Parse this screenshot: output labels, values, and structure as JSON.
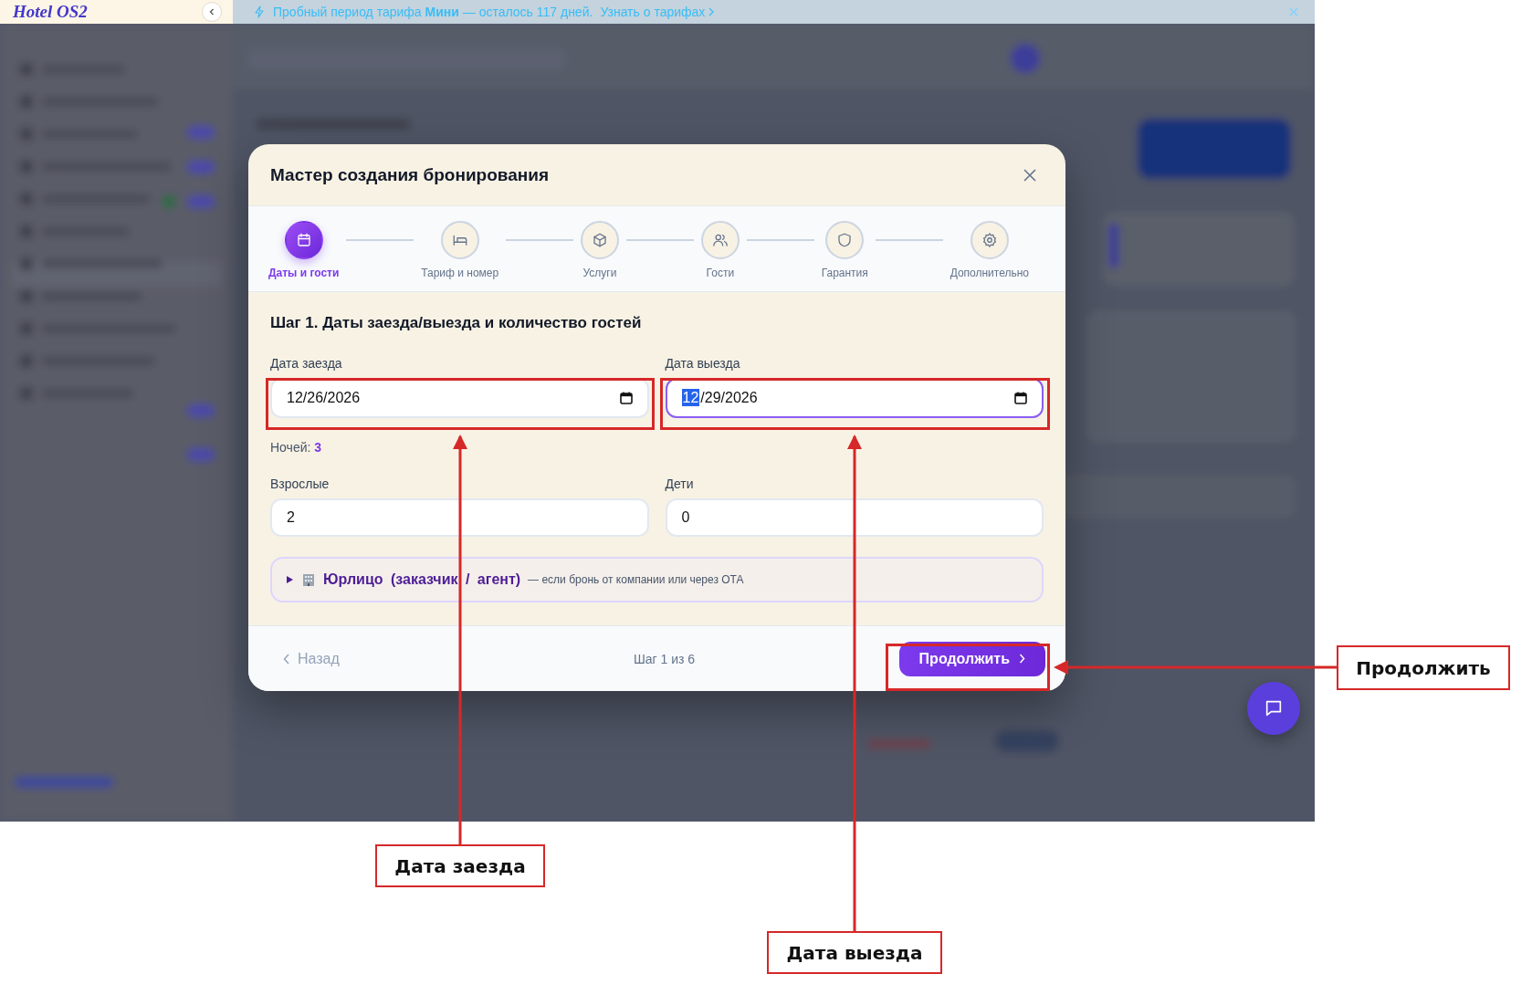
{
  "banner": {
    "logo": "Hotel OS2",
    "message": "Пробный период тарифа **Мини** — осталось 117 дней.",
    "link": "Узнать о тарифах"
  },
  "modal": {
    "title": "Мастер создания бронирования",
    "steps": [
      {
        "label": "Даты и гости",
        "selected": true
      },
      {
        "label": "Тариф и номер",
        "selected": false
      },
      {
        "label": "Услуги",
        "selected": false
      },
      {
        "label": "Гости",
        "selected": false
      },
      {
        "label": "Гарантия",
        "selected": false
      },
      {
        "label": "Дополнительно",
        "selected": false
      }
    ],
    "step_title": "Шаг 1. Даты заезда/выезда и количество гостей",
    "dates": [
      {
        "label": "Дата заезда",
        "value": "12/26/2026",
        "focused": false
      },
      {
        "label": "Дата выезда",
        "value": "12/29/2026",
        "focused": true
      }
    ],
    "nights_label": "Ночей:",
    "nights": "3",
    "guests": [
      {
        "label": "Взрослые",
        "value": "2"
      },
      {
        "label": "Дети",
        "value": "0"
      }
    ],
    "company": {
      "title": "Юрлицо (заказчик / агент)",
      "hint": "— если бронь от компании или через ОТА",
      "expanded": false
    },
    "back": "Назад",
    "progress": "Шаг 1 из 6",
    "next": "Продолжить"
  },
  "annotations": [
    {
      "label": "Дата заезда"
    },
    {
      "label": "Дата выезда"
    },
    {
      "label": "Продолжить"
    }
  ]
}
